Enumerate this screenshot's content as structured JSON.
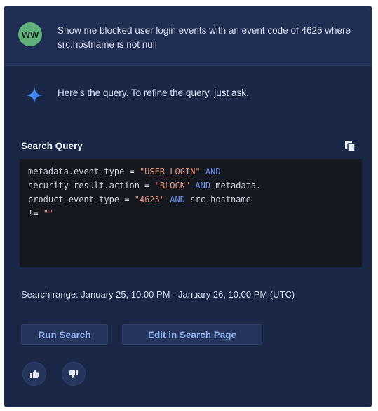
{
  "user_message": {
    "avatar_initials": "WW",
    "text": "Show me blocked user login events with an event code of 4625 where src.hostname is not null"
  },
  "assistant": {
    "intro": "Here's the query. To refine the query, just ask.",
    "search_query_label": "Search Query",
    "code": {
      "l1_a": "metadata.event_type = ",
      "l1_str": "\"USER_LOGIN\"",
      "l1_kw": " AND",
      "l2_a": "security_result.action = ",
      "l2_str": "\"BLOCK\"",
      "l2_kw": " AND",
      "l2_b": " metadata.",
      "l3_a": "product_event_type = ",
      "l3_str": "\"4625\"",
      "l3_kw": " AND",
      "l3_b": " src.hostname",
      "l4_a": "!= ",
      "l4_str": "\"\""
    },
    "search_range": "Search range: January 25, 10:00 PM - January 26, 10:00 PM (UTC)",
    "run_search_label": "Run Search",
    "edit_label": "Edit in Search Page"
  },
  "colors": {
    "panel_bg": "#1c2a4a",
    "accent": "#8fb0f0",
    "avatar": "#5fb07a"
  },
  "icons": {
    "spark": "gemini-spark-icon",
    "copy": "copy-icon",
    "thumbs_up": "thumbs-up-icon",
    "thumbs_down": "thumbs-down-icon"
  }
}
